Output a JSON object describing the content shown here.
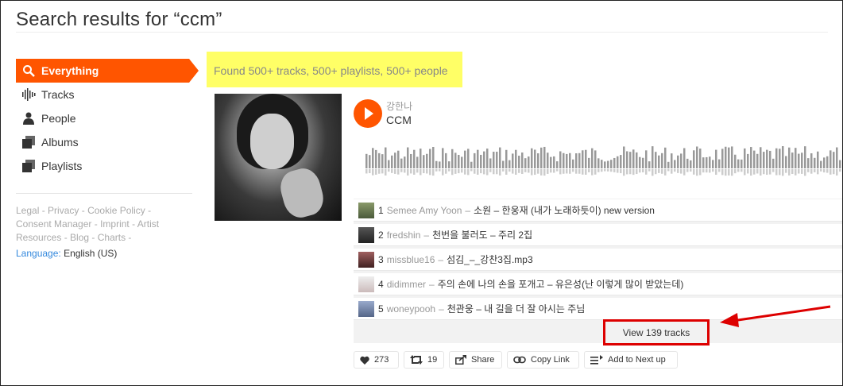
{
  "page": {
    "title": "Search results for “ccm”"
  },
  "sidebar": {
    "items": [
      {
        "label": "Everything",
        "icon": "search-icon",
        "active": true
      },
      {
        "label": "Tracks",
        "icon": "waveform-icon"
      },
      {
        "label": "People",
        "icon": "person-icon"
      },
      {
        "label": "Albums",
        "icon": "album-icon"
      },
      {
        "label": "Playlists",
        "icon": "playlist-icon"
      }
    ],
    "footer": {
      "links": [
        "Legal",
        "Privacy",
        "Cookie Policy",
        "Consent Manager",
        "Imprint",
        "Artist Resources",
        "Blog",
        "Charts"
      ],
      "language_label": "Language:",
      "language_value": "English (US)"
    }
  },
  "results": {
    "summary": "Found 500+ tracks, 500+ playlists, 500+ people",
    "playlist": {
      "uploader": "강한나",
      "title": "CCM",
      "tracks": [
        {
          "num": "1",
          "user": "Semee Amy Yoon",
          "title": "소원 – 한웅재 (내가 노래하듯이) new version"
        },
        {
          "num": "2",
          "user": "fredshin",
          "title": "천번을 불러도 – 주리 2집"
        },
        {
          "num": "3",
          "user": "missblue16",
          "title": "섬김_–_강찬3집.mp3"
        },
        {
          "num": "4",
          "user": "didimmer",
          "title": "주의 손에 나의 손을 포개고 – 유은성(난 이렇게 많이 받았는데)"
        },
        {
          "num": "5",
          "user": "woneypooh",
          "title": "천관웅 – 내 길을 더 잘 아시는 주님"
        }
      ],
      "view_tracks_label": "View 139 tracks",
      "actions": {
        "likes": "273",
        "reposts": "19",
        "share": "Share",
        "copy_link": "Copy Link",
        "add_next": "Add to Next up"
      }
    }
  },
  "colors": {
    "accent": "#ff5500",
    "highlight": "#ffff66",
    "annotation": "#dd0000"
  }
}
